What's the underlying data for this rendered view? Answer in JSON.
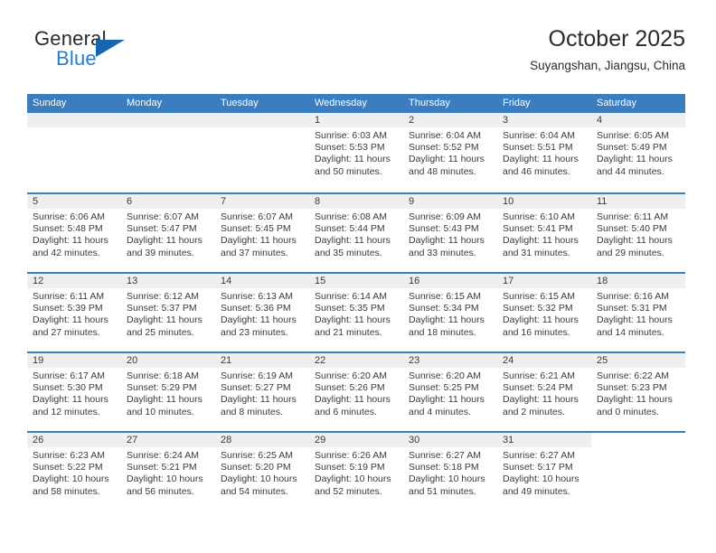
{
  "brand": {
    "word1": "General",
    "word2": "Blue",
    "logo_icon": "triangle-logo-icon",
    "accent_color": "#1565b0",
    "blue_text_color": "#1f7fd0"
  },
  "header": {
    "title": "October 2025",
    "location": "Suyangshan, Jiangsu, China"
  },
  "theme": {
    "header_row_bg": "#3b7dbf",
    "day_number_bg": "#efefef",
    "week_separator": "#3b7dbf",
    "text_color": "#3a3a3a"
  },
  "weekdays": [
    "Sunday",
    "Monday",
    "Tuesday",
    "Wednesday",
    "Thursday",
    "Friday",
    "Saturday"
  ],
  "weeks": [
    [
      {
        "day": "",
        "sunrise": "",
        "sunset": "",
        "daylight_line1": "",
        "daylight_line2": ""
      },
      {
        "day": "",
        "sunrise": "",
        "sunset": "",
        "daylight_line1": "",
        "daylight_line2": ""
      },
      {
        "day": "",
        "sunrise": "",
        "sunset": "",
        "daylight_line1": "",
        "daylight_line2": ""
      },
      {
        "day": "1",
        "sunrise": "Sunrise: 6:03 AM",
        "sunset": "Sunset: 5:53 PM",
        "daylight_line1": "Daylight: 11 hours",
        "daylight_line2": "and 50 minutes."
      },
      {
        "day": "2",
        "sunrise": "Sunrise: 6:04 AM",
        "sunset": "Sunset: 5:52 PM",
        "daylight_line1": "Daylight: 11 hours",
        "daylight_line2": "and 48 minutes."
      },
      {
        "day": "3",
        "sunrise": "Sunrise: 6:04 AM",
        "sunset": "Sunset: 5:51 PM",
        "daylight_line1": "Daylight: 11 hours",
        "daylight_line2": "and 46 minutes."
      },
      {
        "day": "4",
        "sunrise": "Sunrise: 6:05 AM",
        "sunset": "Sunset: 5:49 PM",
        "daylight_line1": "Daylight: 11 hours",
        "daylight_line2": "and 44 minutes."
      }
    ],
    [
      {
        "day": "5",
        "sunrise": "Sunrise: 6:06 AM",
        "sunset": "Sunset: 5:48 PM",
        "daylight_line1": "Daylight: 11 hours",
        "daylight_line2": "and 42 minutes."
      },
      {
        "day": "6",
        "sunrise": "Sunrise: 6:07 AM",
        "sunset": "Sunset: 5:47 PM",
        "daylight_line1": "Daylight: 11 hours",
        "daylight_line2": "and 39 minutes."
      },
      {
        "day": "7",
        "sunrise": "Sunrise: 6:07 AM",
        "sunset": "Sunset: 5:45 PM",
        "daylight_line1": "Daylight: 11 hours",
        "daylight_line2": "and 37 minutes."
      },
      {
        "day": "8",
        "sunrise": "Sunrise: 6:08 AM",
        "sunset": "Sunset: 5:44 PM",
        "daylight_line1": "Daylight: 11 hours",
        "daylight_line2": "and 35 minutes."
      },
      {
        "day": "9",
        "sunrise": "Sunrise: 6:09 AM",
        "sunset": "Sunset: 5:43 PM",
        "daylight_line1": "Daylight: 11 hours",
        "daylight_line2": "and 33 minutes."
      },
      {
        "day": "10",
        "sunrise": "Sunrise: 6:10 AM",
        "sunset": "Sunset: 5:41 PM",
        "daylight_line1": "Daylight: 11 hours",
        "daylight_line2": "and 31 minutes."
      },
      {
        "day": "11",
        "sunrise": "Sunrise: 6:11 AM",
        "sunset": "Sunset: 5:40 PM",
        "daylight_line1": "Daylight: 11 hours",
        "daylight_line2": "and 29 minutes."
      }
    ],
    [
      {
        "day": "12",
        "sunrise": "Sunrise: 6:11 AM",
        "sunset": "Sunset: 5:39 PM",
        "daylight_line1": "Daylight: 11 hours",
        "daylight_line2": "and 27 minutes."
      },
      {
        "day": "13",
        "sunrise": "Sunrise: 6:12 AM",
        "sunset": "Sunset: 5:37 PM",
        "daylight_line1": "Daylight: 11 hours",
        "daylight_line2": "and 25 minutes."
      },
      {
        "day": "14",
        "sunrise": "Sunrise: 6:13 AM",
        "sunset": "Sunset: 5:36 PM",
        "daylight_line1": "Daylight: 11 hours",
        "daylight_line2": "and 23 minutes."
      },
      {
        "day": "15",
        "sunrise": "Sunrise: 6:14 AM",
        "sunset": "Sunset: 5:35 PM",
        "daylight_line1": "Daylight: 11 hours",
        "daylight_line2": "and 21 minutes."
      },
      {
        "day": "16",
        "sunrise": "Sunrise: 6:15 AM",
        "sunset": "Sunset: 5:34 PM",
        "daylight_line1": "Daylight: 11 hours",
        "daylight_line2": "and 18 minutes."
      },
      {
        "day": "17",
        "sunrise": "Sunrise: 6:15 AM",
        "sunset": "Sunset: 5:32 PM",
        "daylight_line1": "Daylight: 11 hours",
        "daylight_line2": "and 16 minutes."
      },
      {
        "day": "18",
        "sunrise": "Sunrise: 6:16 AM",
        "sunset": "Sunset: 5:31 PM",
        "daylight_line1": "Daylight: 11 hours",
        "daylight_line2": "and 14 minutes."
      }
    ],
    [
      {
        "day": "19",
        "sunrise": "Sunrise: 6:17 AM",
        "sunset": "Sunset: 5:30 PM",
        "daylight_line1": "Daylight: 11 hours",
        "daylight_line2": "and 12 minutes."
      },
      {
        "day": "20",
        "sunrise": "Sunrise: 6:18 AM",
        "sunset": "Sunset: 5:29 PM",
        "daylight_line1": "Daylight: 11 hours",
        "daylight_line2": "and 10 minutes."
      },
      {
        "day": "21",
        "sunrise": "Sunrise: 6:19 AM",
        "sunset": "Sunset: 5:27 PM",
        "daylight_line1": "Daylight: 11 hours",
        "daylight_line2": "and 8 minutes."
      },
      {
        "day": "22",
        "sunrise": "Sunrise: 6:20 AM",
        "sunset": "Sunset: 5:26 PM",
        "daylight_line1": "Daylight: 11 hours",
        "daylight_line2": "and 6 minutes."
      },
      {
        "day": "23",
        "sunrise": "Sunrise: 6:20 AM",
        "sunset": "Sunset: 5:25 PM",
        "daylight_line1": "Daylight: 11 hours",
        "daylight_line2": "and 4 minutes."
      },
      {
        "day": "24",
        "sunrise": "Sunrise: 6:21 AM",
        "sunset": "Sunset: 5:24 PM",
        "daylight_line1": "Daylight: 11 hours",
        "daylight_line2": "and 2 minutes."
      },
      {
        "day": "25",
        "sunrise": "Sunrise: 6:22 AM",
        "sunset": "Sunset: 5:23 PM",
        "daylight_line1": "Daylight: 11 hours",
        "daylight_line2": "and 0 minutes."
      }
    ],
    [
      {
        "day": "26",
        "sunrise": "Sunrise: 6:23 AM",
        "sunset": "Sunset: 5:22 PM",
        "daylight_line1": "Daylight: 10 hours",
        "daylight_line2": "and 58 minutes."
      },
      {
        "day": "27",
        "sunrise": "Sunrise: 6:24 AM",
        "sunset": "Sunset: 5:21 PM",
        "daylight_line1": "Daylight: 10 hours",
        "daylight_line2": "and 56 minutes."
      },
      {
        "day": "28",
        "sunrise": "Sunrise: 6:25 AM",
        "sunset": "Sunset: 5:20 PM",
        "daylight_line1": "Daylight: 10 hours",
        "daylight_line2": "and 54 minutes."
      },
      {
        "day": "29",
        "sunrise": "Sunrise: 6:26 AM",
        "sunset": "Sunset: 5:19 PM",
        "daylight_line1": "Daylight: 10 hours",
        "daylight_line2": "and 52 minutes."
      },
      {
        "day": "30",
        "sunrise": "Sunrise: 6:27 AM",
        "sunset": "Sunset: 5:18 PM",
        "daylight_line1": "Daylight: 10 hours",
        "daylight_line2": "and 51 minutes."
      },
      {
        "day": "31",
        "sunrise": "Sunrise: 6:27 AM",
        "sunset": "Sunset: 5:17 PM",
        "daylight_line1": "Daylight: 10 hours",
        "daylight_line2": "and 49 minutes."
      },
      {
        "day": "",
        "sunrise": "",
        "sunset": "",
        "daylight_line1": "",
        "daylight_line2": ""
      }
    ]
  ]
}
